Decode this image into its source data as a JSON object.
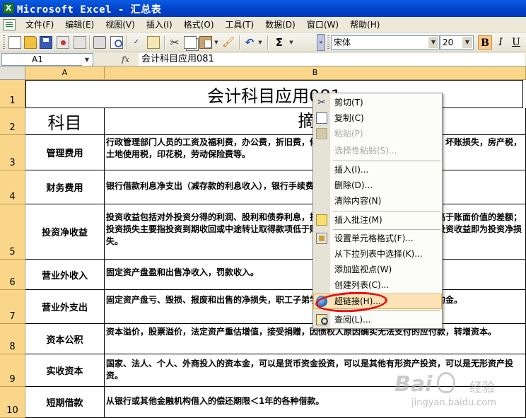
{
  "window": {
    "title": "Microsoft Excel - 汇总表",
    "app_icon_letter": "X"
  },
  "menu": [
    "文件(F)",
    "编辑(E)",
    "视图(V)",
    "插入(I)",
    "格式(O)",
    "工具(T)",
    "数据(D)",
    "窗口(W)",
    "帮助(H)"
  ],
  "toolbar": {
    "font_name": "宋体",
    "font_size": "20",
    "bold": "B",
    "italic": "I",
    "underline": "U",
    "sum": "Σ"
  },
  "formula_bar": {
    "cell_ref": "A1",
    "fx": "fx",
    "content": "会计科目应用081"
  },
  "sheet": {
    "columns": [
      "A",
      "B"
    ],
    "title": "会计科目应用081",
    "header_a": "科目",
    "header_b": "摘要",
    "rows": [
      {
        "row": "1"
      },
      {
        "row": "2"
      },
      {
        "row": "3",
        "a": "管理费用",
        "b": "行政管理部门人员的工资及福利费，办公费，折旧费，修理费，技术转让费，业务招待费，坏账损失，房产税，土地使用税，印花税，劳动保险费等。"
      },
      {
        "row": "4",
        "a": "财务费用",
        "b": "银行借款利息净支出（减存款的利息收入），银行手续费等。"
      },
      {
        "row": "5",
        "a": "投资净收益",
        "b": "投资收益包括对外投资分得的利润、股利和债券利息，投资到期收回或中途转让取得款项高于账面价值的差额；投资损失主要指投资到期收回或中途转让取得款项低于账面价值的差额；若投资损失大于投资收益即为投资净损失。"
      },
      {
        "row": "6",
        "a": "营业外收入",
        "b": "固定资产盘盈和出售净收入，罚款收入。"
      },
      {
        "row": "7",
        "a": "营业外支出",
        "b": "固定资产盘亏、毁损、报废和出售的净损失，职工子弟学校经费，非常损失，赔偿金，违约金。"
      },
      {
        "row": "8",
        "a": "资本公积",
        "b": "资本溢价，股票溢价，法定资产重估增值，接受捐赠，因债权人原因确实无法支付的应付款，转增资本。"
      },
      {
        "row": "9",
        "a": "实收资本",
        "b": "国家、法人、个人、外商投入的资本金，可以是货币资金投资，可以是其他有形资产投资，可以是无形资产投资。"
      },
      {
        "row": "10",
        "a": "短期借款",
        "b": "从银行或其他金融机构借入的偿还期限＜1年的各种借款。"
      }
    ]
  },
  "context_menu": {
    "items": [
      {
        "label": "剪切(T)",
        "icon": "scissors-icon",
        "enabled": true
      },
      {
        "label": "复制(C)",
        "icon": "copy-icon",
        "enabled": true
      },
      {
        "label": "粘贴(P)",
        "icon": "paste-icon",
        "enabled": false
      },
      {
        "label": "选择性粘贴(S)...",
        "enabled": false
      },
      {
        "label": "插入(I)...",
        "enabled": true
      },
      {
        "label": "删除(D)...",
        "enabled": true
      },
      {
        "label": "清除内容(N)",
        "enabled": true
      },
      {
        "label": "插入批注(M)",
        "icon": "comment-icon",
        "enabled": true
      },
      {
        "label": "设置单元格格式(F)...",
        "icon": "format-cells-icon",
        "enabled": true
      },
      {
        "label": "从下拉列表中选择(K)...",
        "enabled": true
      },
      {
        "label": "添加监视点(W)",
        "enabled": true
      },
      {
        "label": "创建列表(C)...",
        "enabled": true
      },
      {
        "label": "超链接(H)...",
        "icon": "hyperlink-globe-icon",
        "enabled": true,
        "highlighted": true
      },
      {
        "label": "查阅(L)...",
        "icon": "research-icon",
        "enabled": true
      }
    ]
  },
  "watermark": {
    "logo": "Bai",
    "text": "经验",
    "url": "jingyan.baidu.com"
  },
  "colors": {
    "title_bar": "#0140c8",
    "header_bg": "#f9d68a",
    "highlight": "#fce3b7",
    "annotation": "#e81010"
  }
}
